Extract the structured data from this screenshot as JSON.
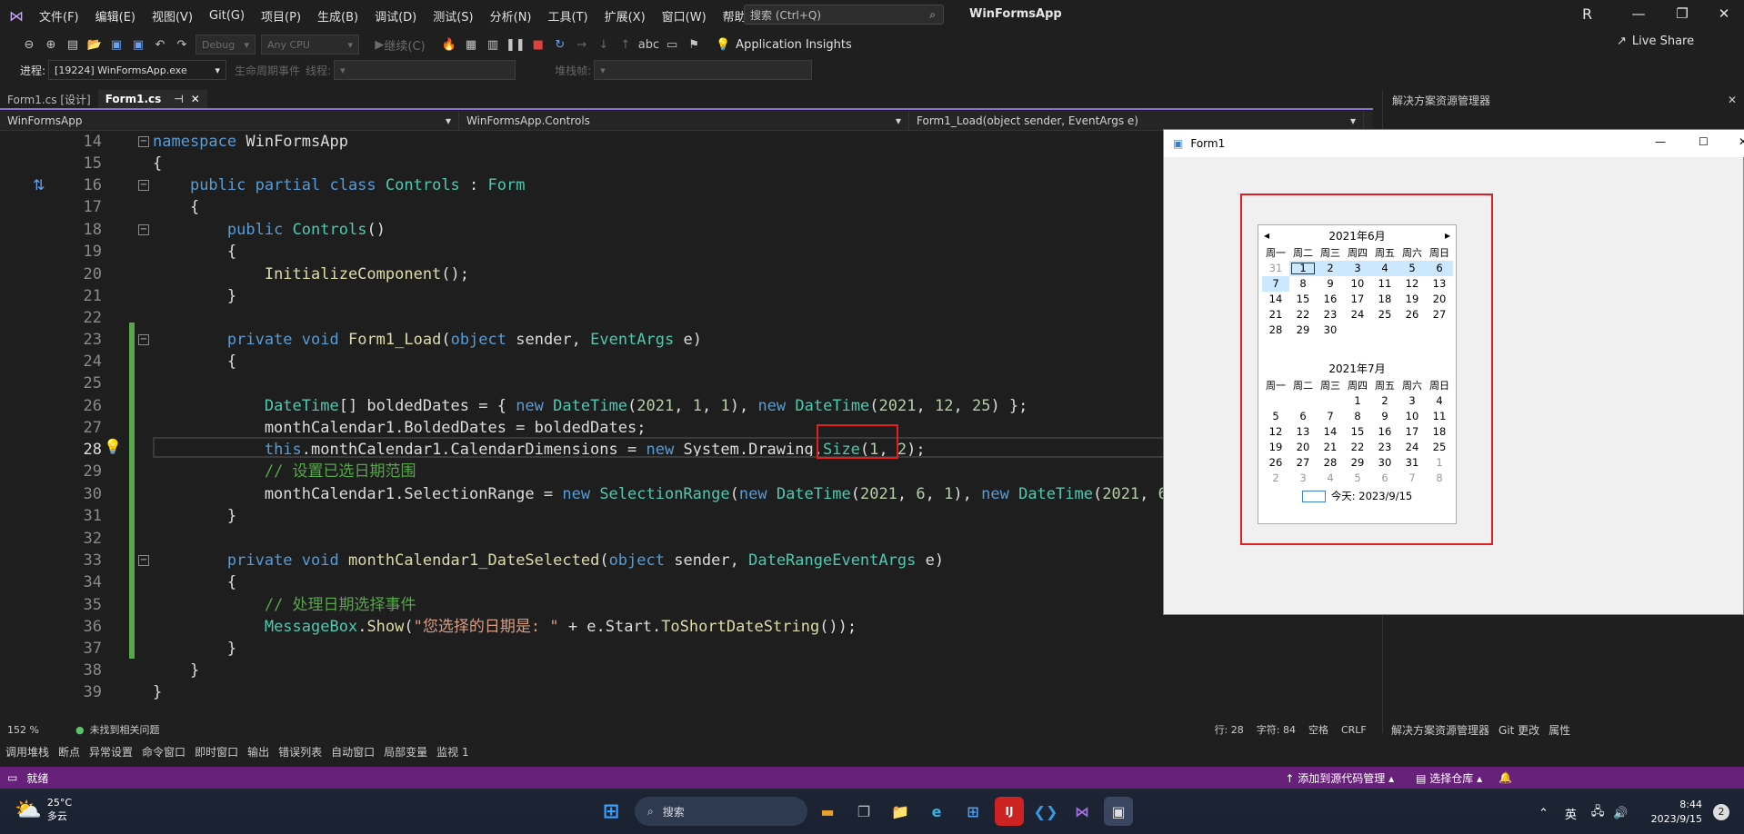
{
  "menu": [
    "文件(F)",
    "编辑(E)",
    "视图(V)",
    "Git(G)",
    "项目(P)",
    "生成(B)",
    "调试(D)",
    "测试(S)",
    "分析(N)",
    "工具(T)",
    "扩展(X)",
    "窗口(W)",
    "帮助(H)"
  ],
  "search": {
    "placeholder": "搜索 (Ctrl+Q)"
  },
  "app_title": "WinFormsApp",
  "user_initial": "R",
  "toolbar": {
    "config": "Debug",
    "platform": "Any CPU",
    "continue": "继续(C)",
    "insights": "Application Insights",
    "live_share": "Live Share"
  },
  "process": {
    "label": "进程:",
    "value": "[19224] WinFormsApp.exe",
    "lifecycle": "生命周期事件",
    "thread": "线程:",
    "stack": "堆栈帧:"
  },
  "tabs": [
    {
      "label": "Form1.cs [设计]"
    },
    {
      "label": "Form1.cs"
    }
  ],
  "nav": {
    "project": "WinFormsApp",
    "class": "WinFormsApp.Controls",
    "member": "Form1_Load(object sender, EventArgs e)"
  },
  "solution_explorer": {
    "title": "解决方案资源管理器",
    "tabs": [
      "解决方案资源管理器",
      "Git 更改",
      "属性"
    ]
  },
  "form1": {
    "title": "Form1"
  },
  "calendar": {
    "month1": "2021年6月",
    "month2": "2021年7月",
    "dow": [
      "周一",
      "周二",
      "周三",
      "周四",
      "周五",
      "周六",
      "周日"
    ],
    "today": "今天: 2023/9/15"
  },
  "editor_status": {
    "zoom": "152 %",
    "issues": "未找到相关问题",
    "line": "行: 28",
    "char": "字符: 84",
    "space": "空格",
    "eol": "CRLF"
  },
  "bottom_tabs": [
    "调用堆栈",
    "断点",
    "异常设置",
    "命令窗口",
    "即时窗口",
    "输出",
    "错误列表",
    "自动窗口",
    "局部变量",
    "监视 1"
  ],
  "status": {
    "ready": "就绪",
    "source_control": "添加到源代码管理",
    "repo": "选择仓库"
  },
  "taskbar": {
    "weather_temp": "25°C",
    "weather_desc": "多云",
    "search": "搜索",
    "ime": "英",
    "time": "8:44",
    "date": "2023/9/15",
    "notif": "2"
  }
}
